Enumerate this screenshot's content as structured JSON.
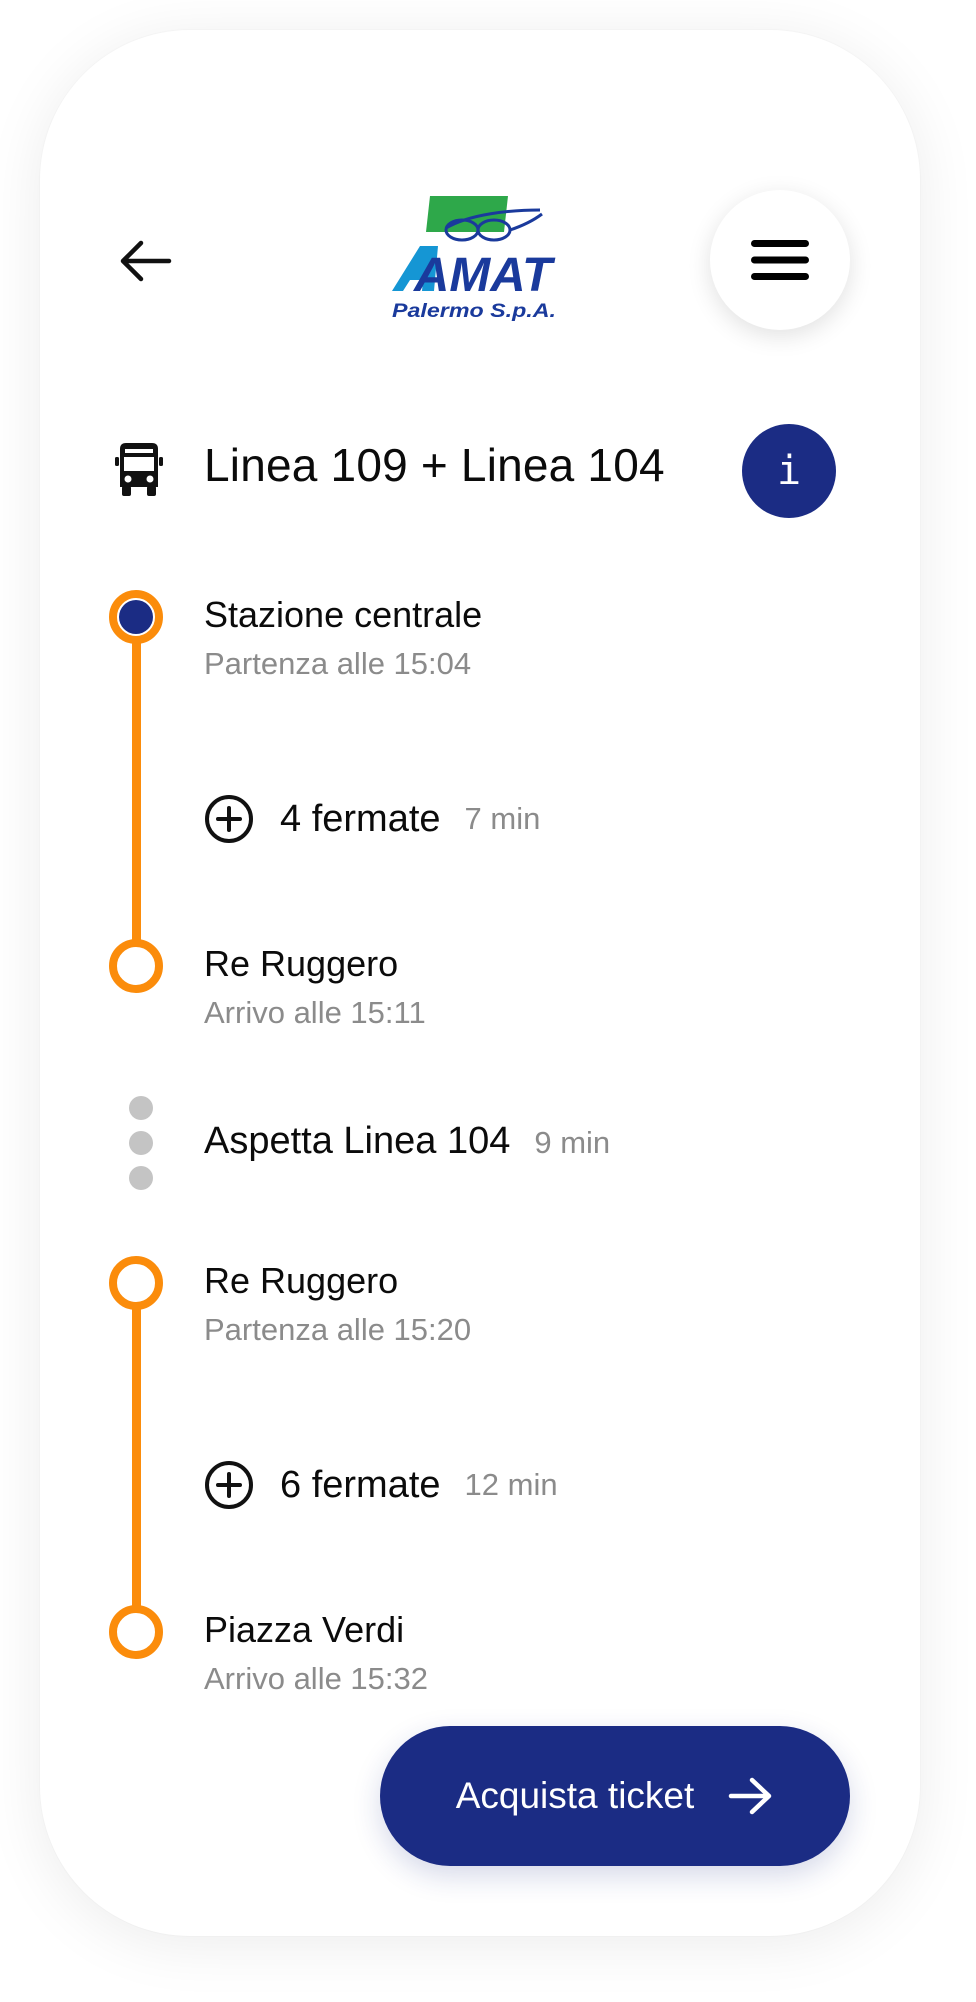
{
  "header": {
    "logo": {
      "brand": "AMAT",
      "subtitle": "Palermo S.p.A.",
      "colors": {
        "blue": "#1a3a9c",
        "cyan": "#1596d4",
        "green": "#2ea84a"
      }
    },
    "back_icon": "arrow-left-icon",
    "menu_icon": "hamburger-menu-icon"
  },
  "route": {
    "title": "Linea 109 + Linea 104",
    "icon": "bus-icon",
    "info_label": "i"
  },
  "timeline": {
    "stop1": {
      "name": "Stazione centrale",
      "sub": "Partenza alle 15:04"
    },
    "segment1": {
      "count": "4 fermate",
      "duration": "7 min"
    },
    "stop2": {
      "name": "Re Ruggero",
      "sub": "Arrivo alle 15:11"
    },
    "wait": {
      "text": "Aspetta Linea 104",
      "duration": "9 min"
    },
    "stop3": {
      "name": "Re Ruggero",
      "sub": "Partenza alle 15:20"
    },
    "segment2": {
      "count": "6 fermate",
      "duration": "12 min"
    },
    "stop4": {
      "name": "Piazza Verdi",
      "sub": "Arrivo alle 15:32"
    }
  },
  "cta": {
    "label": "Acquista ticket",
    "icon": "arrow-right-icon"
  },
  "colors": {
    "accent_orange": "#fb8c0b",
    "primary_blue": "#1b2c84",
    "muted_gray": "#8b8b8b",
    "wait_dot_gray": "#c4c4c4"
  }
}
